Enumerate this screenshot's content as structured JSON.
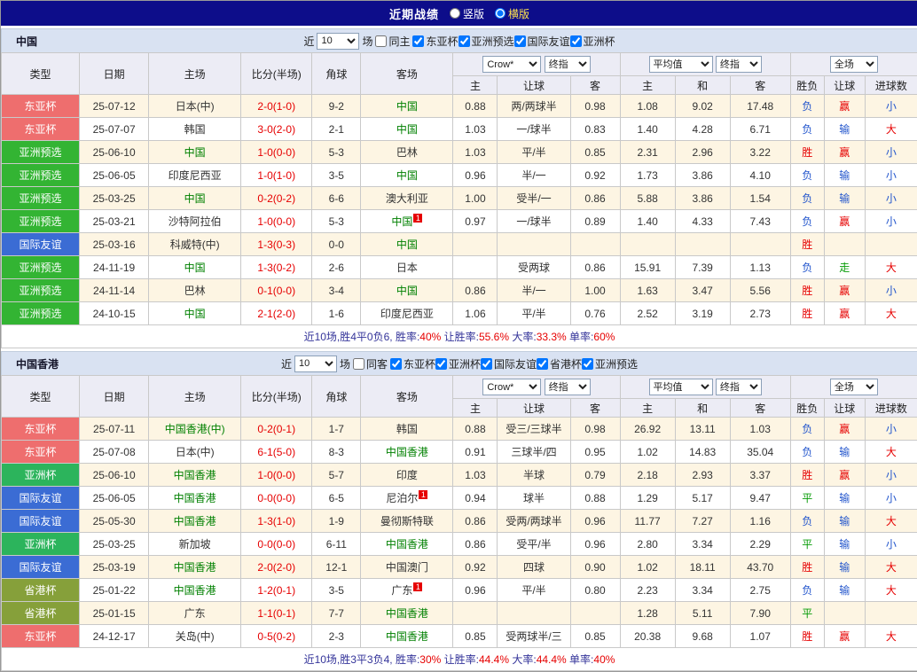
{
  "topbar": {
    "title": "近期战绩",
    "layout_options": [
      {
        "label": "竖版",
        "selected": false
      },
      {
        "label": "横版",
        "selected": true
      }
    ]
  },
  "table_header": {
    "col_type": "类型",
    "col_date": "日期",
    "col_home": "主场",
    "col_score": "比分(半场)",
    "col_corner": "角球",
    "col_away": "客场",
    "group1_selects": [
      "Crow*",
      "终指"
    ],
    "group1_cols": [
      "主",
      "让球",
      "客"
    ],
    "group2_selects": [
      "平均值",
      "终指"
    ],
    "group2_cols": [
      "主",
      "和",
      "客"
    ],
    "group3_selects": [
      "全场"
    ],
    "group3_cols": [
      "胜负",
      "让球",
      "进球数"
    ]
  },
  "type_colors": {
    "东亚杯": "#ee6e6e",
    "亚洲预选": "#33b433",
    "国际友谊": "#3b6cd4",
    "亚洲杯": "#2cb45c",
    "省港杯": "#86a03a"
  },
  "result_colors": {
    "胜": "red",
    "负": "blue",
    "平": "green",
    "赢": "red",
    "输": "blue",
    "走": "green",
    "大": "red",
    "小": "blue"
  },
  "sections": [
    {
      "team": "中国",
      "filter": {
        "prefix": "近",
        "count": "10",
        "suffix": "场",
        "same_label": "同主",
        "same_checked": false,
        "competitions": [
          {
            "label": "东亚杯",
            "checked": true
          },
          {
            "label": "亚洲预选",
            "checked": true
          },
          {
            "label": "国际友谊",
            "checked": true
          },
          {
            "label": "亚洲杯",
            "checked": true
          }
        ]
      },
      "rows": [
        {
          "type": "东亚杯",
          "date": "25-07-12",
          "home": "日本(中)",
          "home_focal": false,
          "score": "2-0(1-0)",
          "corners": "9-2",
          "away": "中国",
          "away_focal": true,
          "odds_home": "0.88",
          "handicap": "两/两球半",
          "odds_away": "0.98",
          "avg_home": "1.08",
          "avg_draw": "9.02",
          "avg_away": "17.48",
          "result": "负",
          "handicap_result": "赢",
          "goals": "小"
        },
        {
          "type": "东亚杯",
          "date": "25-07-07",
          "home": "韩国",
          "home_focal": false,
          "score": "3-0(2-0)",
          "corners": "2-1",
          "away": "中国",
          "away_focal": true,
          "odds_home": "1.03",
          "handicap": "一/球半",
          "odds_away": "0.83",
          "avg_home": "1.40",
          "avg_draw": "4.28",
          "avg_away": "6.71",
          "result": "负",
          "handicap_result": "输",
          "goals": "大"
        },
        {
          "type": "亚洲预选",
          "date": "25-06-10",
          "home": "中国",
          "home_focal": true,
          "score": "1-0(0-0)",
          "corners": "5-3",
          "away": "巴林",
          "away_focal": false,
          "odds_home": "1.03",
          "handicap": "平/半",
          "odds_away": "0.85",
          "avg_home": "2.31",
          "avg_draw": "2.96",
          "avg_away": "3.22",
          "result": "胜",
          "handicap_result": "赢",
          "goals": "小"
        },
        {
          "type": "亚洲预选",
          "date": "25-06-05",
          "home": "印度尼西亚",
          "home_focal": false,
          "score": "1-0(1-0)",
          "corners": "3-5",
          "away": "中国",
          "away_focal": true,
          "odds_home": "0.96",
          "handicap": "半/一",
          "odds_away": "0.92",
          "avg_home": "1.73",
          "avg_draw": "3.86",
          "avg_away": "4.10",
          "result": "负",
          "handicap_result": "输",
          "goals": "小"
        },
        {
          "type": "亚洲预选",
          "date": "25-03-25",
          "home": "中国",
          "home_focal": true,
          "score": "0-2(0-2)",
          "corners": "6-6",
          "away": "澳大利亚",
          "away_focal": false,
          "odds_home": "1.00",
          "handicap": "受半/一",
          "odds_away": "0.86",
          "avg_home": "5.88",
          "avg_draw": "3.86",
          "avg_away": "1.54",
          "result": "负",
          "handicap_result": "输",
          "goals": "小"
        },
        {
          "type": "亚洲预选",
          "date": "25-03-21",
          "home": "沙特阿拉伯",
          "home_focal": false,
          "score": "1-0(0-0)",
          "corners": "5-3",
          "away": "中国",
          "away_focal": true,
          "away_card": "1",
          "odds_home": "0.97",
          "handicap": "一/球半",
          "odds_away": "0.89",
          "avg_home": "1.40",
          "avg_draw": "4.33",
          "avg_away": "7.43",
          "result": "负",
          "handicap_result": "赢",
          "goals": "小"
        },
        {
          "type": "国际友谊",
          "date": "25-03-16",
          "home": "科威特(中)",
          "home_focal": false,
          "score": "1-3(0-3)",
          "corners": "0-0",
          "away": "中国",
          "away_focal": true,
          "odds_home": "",
          "handicap": "",
          "odds_away": "",
          "avg_home": "",
          "avg_draw": "",
          "avg_away": "",
          "result": "胜",
          "handicap_result": "",
          "goals": ""
        },
        {
          "type": "亚洲预选",
          "date": "24-11-19",
          "home": "中国",
          "home_focal": true,
          "score": "1-3(0-2)",
          "corners": "2-6",
          "away": "日本",
          "away_focal": false,
          "odds_home": "",
          "handicap": "受两球",
          "odds_away": "0.86",
          "avg_home": "15.91",
          "avg_draw": "7.39",
          "avg_away": "1.13",
          "result": "负",
          "handicap_result": "走",
          "goals": "大"
        },
        {
          "type": "亚洲预选",
          "date": "24-11-14",
          "home": "巴林",
          "home_focal": false,
          "score": "0-1(0-0)",
          "corners": "3-4",
          "away": "中国",
          "away_focal": true,
          "odds_home": "0.86",
          "handicap": "半/一",
          "odds_away": "1.00",
          "avg_home": "1.63",
          "avg_draw": "3.47",
          "avg_away": "5.56",
          "result": "胜",
          "handicap_result": "赢",
          "goals": "小"
        },
        {
          "type": "亚洲预选",
          "date": "24-10-15",
          "home": "中国",
          "home_focal": true,
          "score": "2-1(2-0)",
          "corners": "1-6",
          "away": "印度尼西亚",
          "away_focal": false,
          "odds_home": "1.06",
          "handicap": "平/半",
          "odds_away": "0.76",
          "avg_home": "2.52",
          "avg_draw": "3.19",
          "avg_away": "2.73",
          "result": "胜",
          "handicap_result": "赢",
          "goals": "大"
        }
      ],
      "summary": {
        "record": "近10场,胜4平0负6,",
        "stats": [
          {
            "label": "胜率:",
            "value": "40%"
          },
          {
            "label": "让胜率:",
            "value": "55.6%"
          },
          {
            "label": "大率:",
            "value": "33.3%"
          },
          {
            "label": "单率:",
            "value": "60%"
          }
        ]
      }
    },
    {
      "team": "中国香港",
      "filter": {
        "prefix": "近",
        "count": "10",
        "suffix": "场",
        "same_label": "同客",
        "same_checked": false,
        "competitions": [
          {
            "label": "东亚杯",
            "checked": true
          },
          {
            "label": "亚洲杯",
            "checked": true
          },
          {
            "label": "国际友谊",
            "checked": true
          },
          {
            "label": "省港杯",
            "checked": true
          },
          {
            "label": "亚洲预选",
            "checked": true
          }
        ]
      },
      "rows": [
        {
          "type": "东亚杯",
          "date": "25-07-11",
          "home": "中国香港(中)",
          "home_focal": true,
          "score": "0-2(0-1)",
          "corners": "1-7",
          "away": "韩国",
          "away_focal": false,
          "odds_home": "0.88",
          "handicap": "受三/三球半",
          "odds_away": "0.98",
          "avg_home": "26.92",
          "avg_draw": "13.11",
          "avg_away": "1.03",
          "result": "负",
          "handicap_result": "赢",
          "goals": "小"
        },
        {
          "type": "东亚杯",
          "date": "25-07-08",
          "home": "日本(中)",
          "home_focal": false,
          "score": "6-1(5-0)",
          "corners": "8-3",
          "away": "中国香港",
          "away_focal": true,
          "odds_home": "0.91",
          "handicap": "三球半/四",
          "odds_away": "0.95",
          "avg_home": "1.02",
          "avg_draw": "14.83",
          "avg_away": "35.04",
          "result": "负",
          "handicap_result": "输",
          "goals": "大"
        },
        {
          "type": "亚洲杯",
          "date": "25-06-10",
          "home": "中国香港",
          "home_focal": true,
          "score": "1-0(0-0)",
          "corners": "5-7",
          "away": "印度",
          "away_focal": false,
          "odds_home": "1.03",
          "handicap": "半球",
          "odds_away": "0.79",
          "avg_home": "2.18",
          "avg_draw": "2.93",
          "avg_away": "3.37",
          "result": "胜",
          "handicap_result": "赢",
          "goals": "小"
        },
        {
          "type": "国际友谊",
          "date": "25-06-05",
          "home": "中国香港",
          "home_focal": true,
          "score": "0-0(0-0)",
          "corners": "6-5",
          "away": "尼泊尔",
          "away_focal": false,
          "away_card": "1",
          "odds_home": "0.94",
          "handicap": "球半",
          "odds_away": "0.88",
          "avg_home": "1.29",
          "avg_draw": "5.17",
          "avg_away": "9.47",
          "result": "平",
          "handicap_result": "输",
          "goals": "小"
        },
        {
          "type": "国际友谊",
          "date": "25-05-30",
          "home": "中国香港",
          "home_focal": true,
          "score": "1-3(1-0)",
          "corners": "1-9",
          "away": "曼彻斯特联",
          "away_focal": false,
          "odds_home": "0.86",
          "handicap": "受两/两球半",
          "odds_away": "0.96",
          "avg_home": "11.77",
          "avg_draw": "7.27",
          "avg_away": "1.16",
          "result": "负",
          "handicap_result": "输",
          "goals": "大"
        },
        {
          "type": "亚洲杯",
          "date": "25-03-25",
          "home": "新加坡",
          "home_focal": false,
          "score": "0-0(0-0)",
          "corners": "6-11",
          "away": "中国香港",
          "away_focal": true,
          "odds_home": "0.86",
          "handicap": "受平/半",
          "odds_away": "0.96",
          "avg_home": "2.80",
          "avg_draw": "3.34",
          "avg_away": "2.29",
          "result": "平",
          "handicap_result": "输",
          "goals": "小"
        },
        {
          "type": "国际友谊",
          "date": "25-03-19",
          "home": "中国香港",
          "home_focal": true,
          "score": "2-0(2-0)",
          "corners": "12-1",
          "away": "中国澳门",
          "away_focal": false,
          "odds_home": "0.92",
          "handicap": "四球",
          "odds_away": "0.90",
          "avg_home": "1.02",
          "avg_draw": "18.11",
          "avg_away": "43.70",
          "result": "胜",
          "handicap_result": "输",
          "goals": "大"
        },
        {
          "type": "省港杯",
          "date": "25-01-22",
          "home": "中国香港",
          "home_focal": true,
          "score": "1-2(0-1)",
          "corners": "3-5",
          "away": "广东",
          "away_focal": false,
          "away_card": "1",
          "odds_home": "0.96",
          "handicap": "平/半",
          "odds_away": "0.80",
          "avg_home": "2.23",
          "avg_draw": "3.34",
          "avg_away": "2.75",
          "result": "负",
          "handicap_result": "输",
          "goals": "大"
        },
        {
          "type": "省港杯",
          "date": "25-01-15",
          "home": "广东",
          "home_focal": false,
          "score": "1-1(0-1)",
          "corners": "7-7",
          "away": "中国香港",
          "away_focal": true,
          "odds_home": "",
          "handicap": "",
          "odds_away": "",
          "avg_home": "1.28",
          "avg_draw": "5.11",
          "avg_away": "7.90",
          "result": "平",
          "handicap_result": "",
          "goals": ""
        },
        {
          "type": "东亚杯",
          "date": "24-12-17",
          "home": "关岛(中)",
          "home_focal": false,
          "score": "0-5(0-2)",
          "corners": "2-3",
          "away": "中国香港",
          "away_focal": true,
          "odds_home": "0.85",
          "handicap": "受两球半/三",
          "odds_away": "0.85",
          "avg_home": "20.38",
          "avg_draw": "9.68",
          "avg_away": "1.07",
          "result": "胜",
          "handicap_result": "赢",
          "goals": "大"
        }
      ],
      "summary": {
        "record": "近10场,胜3平3负4,",
        "stats": [
          {
            "label": "胜率:",
            "value": "30%"
          },
          {
            "label": "让胜率:",
            "value": "44.4%"
          },
          {
            "label": "大率:",
            "value": "44.4%"
          },
          {
            "label": "单率:",
            "value": "40%"
          }
        ]
      }
    }
  ]
}
